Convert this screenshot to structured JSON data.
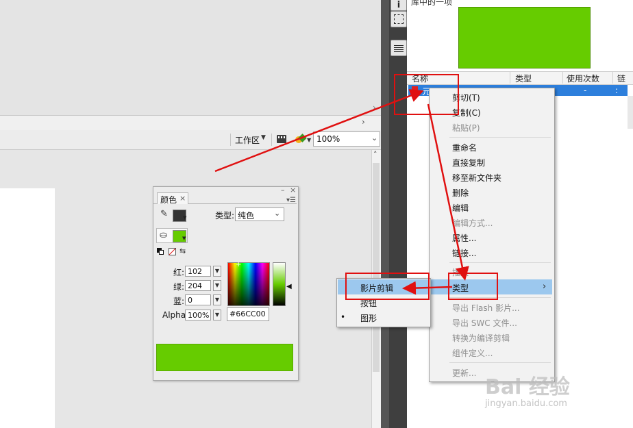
{
  "toolbar": {
    "workspace_label": "工作区",
    "zoom_value": "100%"
  },
  "library": {
    "title": "库中的一项",
    "columns": [
      "名称",
      "类型",
      "使用次数",
      "链接"
    ],
    "selected_item": {
      "name": "元",
      "use_count": "-",
      "link": ":"
    },
    "preview_color": "#66CC00"
  },
  "context_menu": {
    "items": [
      {
        "label": "剪切(T)",
        "disabled": false
      },
      {
        "label": "复制(C)",
        "disabled": false
      },
      {
        "label": "粘贴(P)",
        "disabled": true
      },
      {
        "label": "重命名",
        "disabled": false
      },
      {
        "label": "直接复制",
        "disabled": false
      },
      {
        "label": "移至新文件夹",
        "disabled": false
      },
      {
        "label": "删除",
        "disabled": false
      },
      {
        "label": "编辑",
        "disabled": false
      },
      {
        "label": "编辑方式...",
        "disabled": true
      },
      {
        "label": "属性...",
        "disabled": false
      },
      {
        "label": "链接...",
        "disabled": false
      },
      {
        "label": "播放",
        "disabled": true
      },
      {
        "label": "类型",
        "disabled": false
      },
      {
        "label": "导出 Flash 影片...",
        "disabled": true
      },
      {
        "label": "导出 SWC 文件...",
        "disabled": true
      },
      {
        "label": "转换为编译剪辑",
        "disabled": true
      },
      {
        "label": "组件定义...",
        "disabled": true
      },
      {
        "label": "更新...",
        "disabled": true
      }
    ],
    "submenu_arrow": "›"
  },
  "type_submenu": {
    "items": [
      {
        "label": "影片剪辑",
        "selected": false
      },
      {
        "label": "按钮",
        "selected": false
      },
      {
        "label": "图形",
        "selected": true
      }
    ]
  },
  "color_panel": {
    "tab_label": "颜色",
    "type_label": "类型:",
    "type_value": "纯色",
    "red_label": "红:",
    "red_value": "102",
    "green_label": "绿:",
    "green_value": "204",
    "blue_label": "蓝:",
    "blue_value": "0",
    "alpha_label": "Alpha:",
    "alpha_value": "100%",
    "hex_value": "#66CC00",
    "fill_color": "#66CC00",
    "stroke_color": "#333333"
  },
  "watermark": {
    "text": "Bai 经验",
    "url": "jingyan.baidu.com"
  }
}
